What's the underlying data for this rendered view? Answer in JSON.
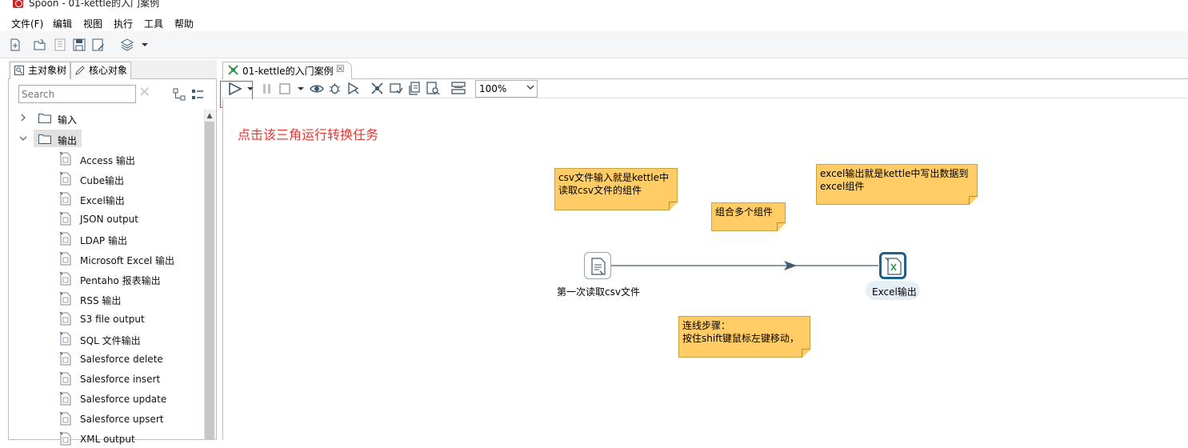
{
  "window": {
    "title": "Spoon - 01-kettle的入门案例"
  },
  "menu": [
    {
      "label": "文件(F)"
    },
    {
      "label": "编辑"
    },
    {
      "label": "视图"
    },
    {
      "label": "执行"
    },
    {
      "label": "工具"
    },
    {
      "label": "帮助"
    }
  ],
  "left_panel": {
    "tabs": [
      {
        "label": "主对象树",
        "icon": "search-icon"
      },
      {
        "label": "核心对象",
        "icon": "pencil-icon"
      }
    ],
    "search": {
      "placeholder": "Search",
      "value": ""
    },
    "folders": [
      {
        "label": "输入",
        "expanded": false
      },
      {
        "label": "输出",
        "expanded": true
      }
    ],
    "output_items": [
      {
        "label": "Access 输出",
        "icon": "access-output-icon"
      },
      {
        "label": "Cube输出",
        "icon": "cube-output-icon"
      },
      {
        "label": "Excel输出",
        "icon": "excel-output-icon"
      },
      {
        "label": "JSON output",
        "icon": "json-output-icon"
      },
      {
        "label": "LDAP 输出",
        "icon": "ldap-output-icon"
      },
      {
        "label": "Microsoft Excel 输出",
        "icon": "ms-excel-output-icon"
      },
      {
        "label": "Pentaho 报表输出",
        "icon": "pentaho-report-icon"
      },
      {
        "label": "RSS 输出",
        "icon": "rss-output-icon"
      },
      {
        "label": "S3 file output",
        "icon": "s3-output-icon"
      },
      {
        "label": "SQL 文件输出",
        "icon": "sql-file-output-icon"
      },
      {
        "label": "Salesforce delete",
        "icon": "salesforce-delete-icon"
      },
      {
        "label": "Salesforce insert",
        "icon": "salesforce-insert-icon"
      },
      {
        "label": "Salesforce update",
        "icon": "salesforce-update-icon"
      },
      {
        "label": "Salesforce upsert",
        "icon": "salesforce-upsert-icon"
      },
      {
        "label": "XML output",
        "icon": "xml-output-icon"
      }
    ]
  },
  "editor": {
    "tab": {
      "label": "01-kettle的入门案例"
    },
    "zoom": "100%",
    "annotation": "点击该三角运行转换任务",
    "notes": [
      {
        "text": "csv文件输入就是kettle中\n读取csv文件的组件"
      },
      {
        "text": "组合多个组件"
      },
      {
        "text": "excel输出就是kettle中写出数据到\nexcel组件"
      },
      {
        "text": "连线步骤：\n按住shift键鼠标左键移动，"
      }
    ],
    "steps": [
      {
        "label": "第一次读取csv文件",
        "icon": "csv-input-icon"
      },
      {
        "label": "Excel输出",
        "icon": "excel-output-icon"
      }
    ]
  },
  "colors": {
    "note": "#ffcc66",
    "annotation": "#e53935",
    "hop": "#3d5a73",
    "selected_step": "#1f5f8b"
  }
}
